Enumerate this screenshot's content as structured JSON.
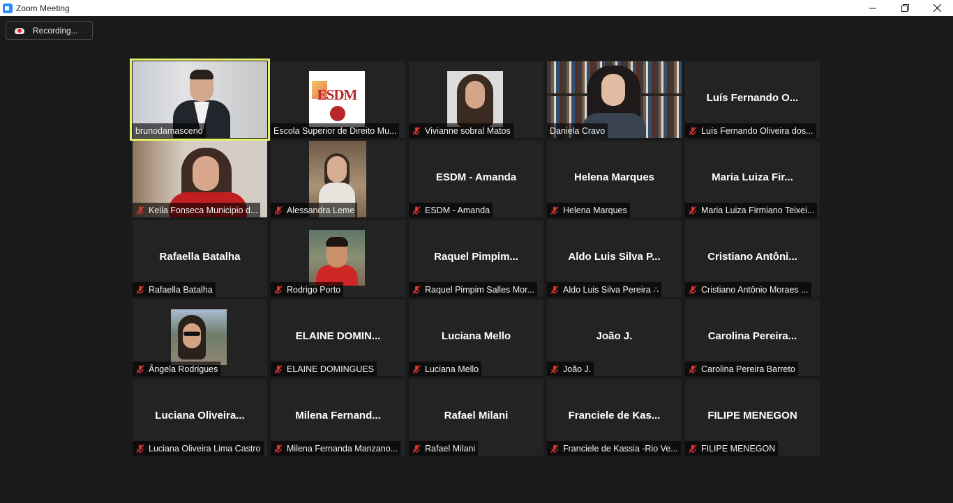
{
  "window": {
    "title": "Zoom Meeting"
  },
  "recording": {
    "label": "Recording..."
  },
  "colors": {
    "active_speaker_border": "#e7f06a",
    "muted_icon": "#e0322f",
    "tile_bg": "#232323"
  },
  "participants": [
    {
      "display_name": "",
      "label": "brunodamasceno",
      "muted": false,
      "video": "bruno",
      "active": true
    },
    {
      "display_name": "",
      "label": "Escola Superior de Direito Mu...",
      "muted": false,
      "video": "logo"
    },
    {
      "display_name": "",
      "label": "Vivianne sobral Matos",
      "muted": true,
      "video": "vivianne"
    },
    {
      "display_name": "",
      "label": "Daniela Cravo",
      "muted": false,
      "video": "daniela"
    },
    {
      "display_name": "Luís  Fernando  O...",
      "label": "Luís Fernando Oliveira dos...",
      "muted": true,
      "video": ""
    },
    {
      "display_name": "",
      "label": "Keila Fonseca Municipio d...",
      "muted": true,
      "video": "keila"
    },
    {
      "display_name": "",
      "label": "Alessandra Leme",
      "muted": true,
      "video": "alessandra"
    },
    {
      "display_name": "ESDM - Amanda",
      "label": "ESDM - Amanda",
      "muted": true,
      "video": ""
    },
    {
      "display_name": "Helena Marques",
      "label": "Helena Marques",
      "muted": true,
      "video": ""
    },
    {
      "display_name": "Maria  Luiza  Fir...",
      "label": "Maria Luiza Firmiano Teixei...",
      "muted": true,
      "video": ""
    },
    {
      "display_name": "Rafaella Batalha",
      "label": "Rafaella Batalha",
      "muted": true,
      "video": ""
    },
    {
      "display_name": "",
      "label": "Rodrigo Porto",
      "muted": true,
      "video": "rodrigo"
    },
    {
      "display_name": "Raquel  Pimpim...",
      "label": "Raquel Pimpim Salles Mor...",
      "muted": true,
      "video": ""
    },
    {
      "display_name": "Aldo  Luis  Silva  P...",
      "label": "Aldo Luis Silva Pereira ∴",
      "muted": true,
      "video": ""
    },
    {
      "display_name": "Cristiano  Antôni...",
      "label": "Cristiano Antônio Moraes ...",
      "muted": true,
      "video": ""
    },
    {
      "display_name": "",
      "label": "Ângela Rodrigues",
      "muted": true,
      "video": "angela"
    },
    {
      "display_name": "ELAINE  DOMIN...",
      "label": "ELAINE DOMINGUES",
      "muted": true,
      "video": ""
    },
    {
      "display_name": "Luciana Mello",
      "label": "Luciana Mello",
      "muted": true,
      "video": ""
    },
    {
      "display_name": "João J.",
      "label": "João J.",
      "muted": true,
      "video": ""
    },
    {
      "display_name": "Carolina  Pereira...",
      "label": "Carolina Pereira Barreto",
      "muted": true,
      "video": ""
    },
    {
      "display_name": "Luciana  Oliveira...",
      "label": "Luciana Oliveira Lima Castro",
      "muted": true,
      "video": ""
    },
    {
      "display_name": "Milena  Fernand...",
      "label": "Milena Fernanda Manzano...",
      "muted": true,
      "video": ""
    },
    {
      "display_name": "Rafael Milani",
      "label": "Rafael Milani",
      "muted": true,
      "video": ""
    },
    {
      "display_name": "Franciele  de  Kas...",
      "label": "Franciele de Kassia -Rio Ve...",
      "muted": true,
      "video": ""
    },
    {
      "display_name": "FILIPE MENEGON",
      "label": "FILIPE MENEGON",
      "muted": true,
      "video": ""
    }
  ]
}
